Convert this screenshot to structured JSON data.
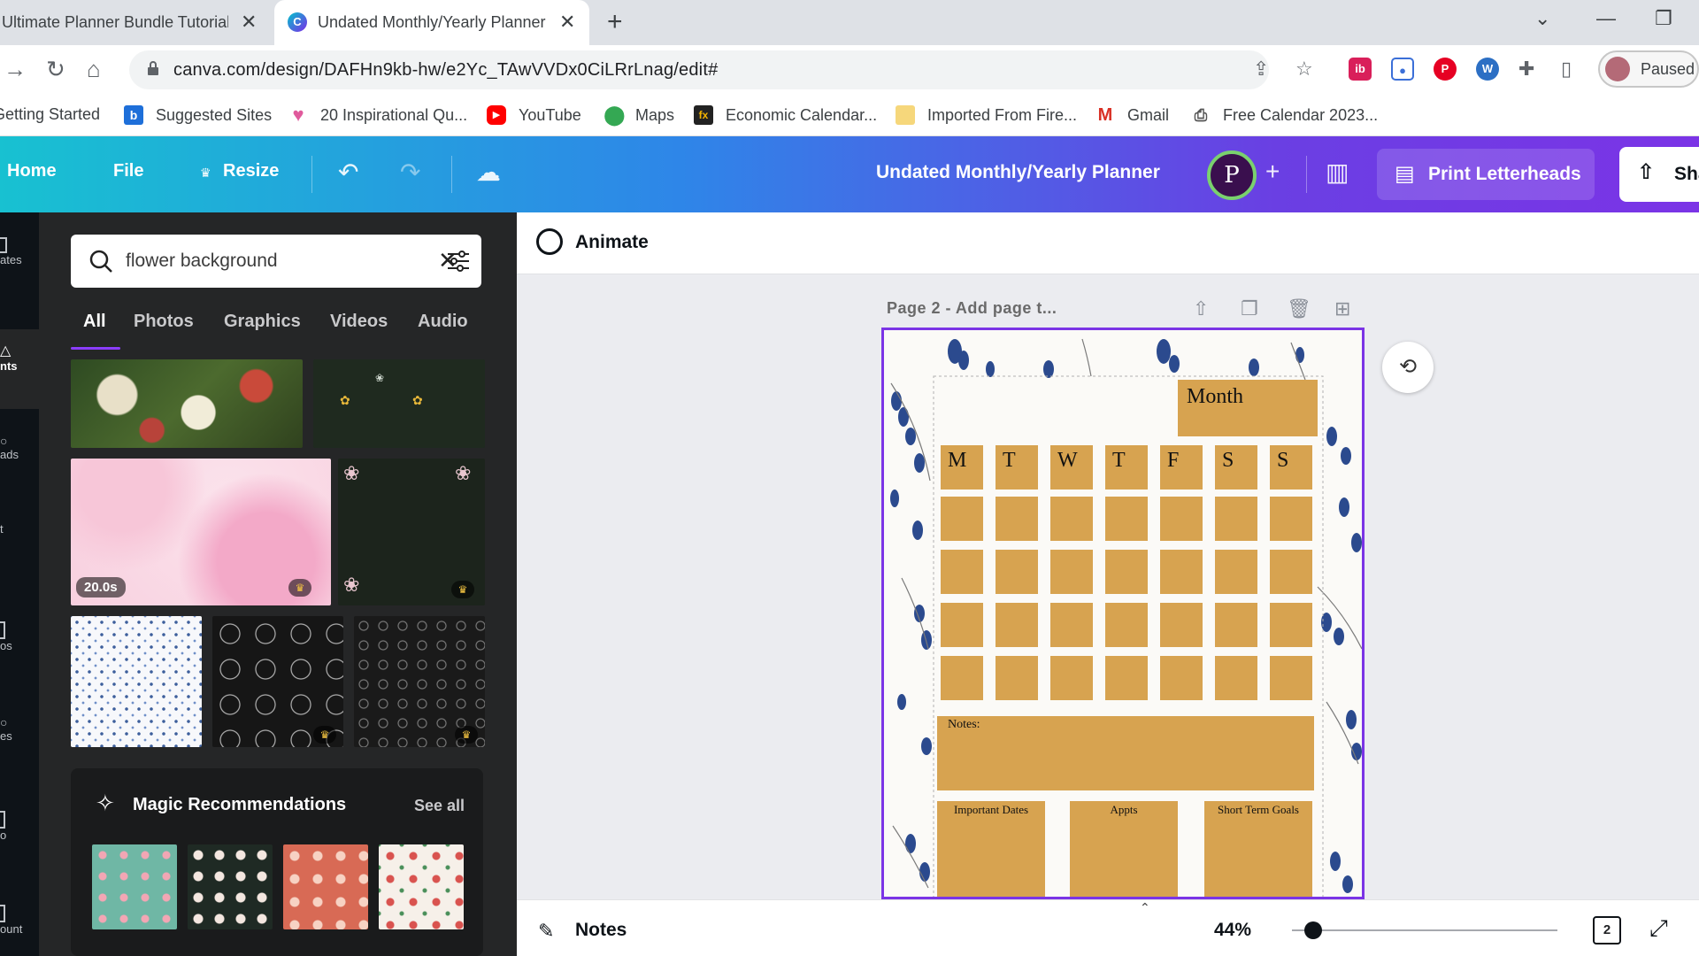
{
  "browser": {
    "tabs": [
      {
        "title": "Ultimate Planner Bundle Tutorial"
      },
      {
        "title": "Undated Monthly/Yearly Planner"
      }
    ],
    "url": "canva.com/design/DAFHn9kb-hw/e2Yc_TAwVVDx0CiLRrLnag/edit#",
    "profile_status": "Paused",
    "bookmarks": [
      {
        "label": "Getting Started",
        "icon": "bookmark-getting-started-icon"
      },
      {
        "label": "Suggested Sites",
        "icon": "suggested-sites-icon"
      },
      {
        "label": "20 Inspirational Qu...",
        "icon": "heart-icon"
      },
      {
        "label": "YouTube",
        "icon": "youtube-icon"
      },
      {
        "label": "Maps",
        "icon": "maps-pin-icon"
      },
      {
        "label": "Economic Calendar...",
        "icon": "fx-icon"
      },
      {
        "label": "Imported From Fire...",
        "icon": "folder-icon"
      },
      {
        "label": "Gmail",
        "icon": "gmail-icon"
      },
      {
        "label": "Free Calendar 2023...",
        "icon": "printer-icon"
      }
    ]
  },
  "header": {
    "home": "Home",
    "file": "File",
    "resize": "Resize",
    "doc_title": "Undated Monthly/Yearly Planner",
    "print_label": "Print Letterheads",
    "share_label": "Share",
    "avatar_initial": "P"
  },
  "panel": {
    "search_value": "flower background",
    "tabs": [
      "All",
      "Photos",
      "Graphics",
      "Videos",
      "Audio"
    ],
    "active_tab": "All",
    "video_duration": "20.0s",
    "magic_title": "Magic Recommendations",
    "see_all": "See all"
  },
  "rail": {
    "labels": [
      "ates",
      "nts",
      "ads",
      "t",
      "os",
      "es",
      "o",
      "ount"
    ]
  },
  "toolbar": {
    "animate": "Animate"
  },
  "page": {
    "label": "Page 2 - Add page t...",
    "month_label": "Month",
    "weekdays": [
      "M",
      "T",
      "W",
      "T",
      "F",
      "S",
      "S"
    ],
    "notes_label": "Notes:",
    "sub_boxes": [
      "Important Dates",
      "Appts",
      "Short Term Goals"
    ]
  },
  "bottom": {
    "notes": "Notes",
    "zoom": "44%",
    "page_count": "2"
  },
  "colors": {
    "planner_box": "#d7a350",
    "canva_purple": "#7b34e6",
    "canva_teal": "#18c1d1",
    "panel_bg": "#252627"
  }
}
